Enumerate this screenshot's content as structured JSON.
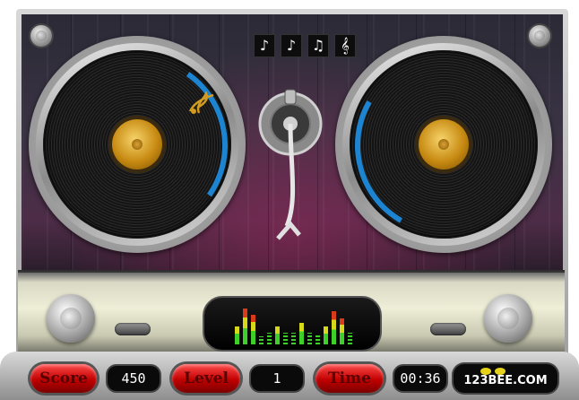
{
  "colors": {
    "accent_blue": "#1d84d1",
    "label_gold": "#d39b1f",
    "pill_red": "#c00000",
    "eq_green": "#3fcf2b",
    "eq_yellow": "#d8d81a",
    "eq_red": "#d83a1a"
  },
  "note_buttons": [
    {
      "symbol": "♪",
      "icon": "eighth-note-icon"
    },
    {
      "symbol": "♪",
      "icon": "eighth-note-icon"
    },
    {
      "symbol": "♫",
      "icon": "beamed-notes-icon"
    },
    {
      "symbol": "𝄞",
      "icon": "treble-clef-icon"
    }
  ],
  "hud": {
    "score_label": "Score",
    "score_value": "450",
    "level_label": "Level",
    "level_value": "1",
    "time_label": "Time",
    "time_value": "00:36"
  },
  "brand": {
    "logo_text": "123BEE.COM"
  },
  "equalizer": {
    "levels": [
      0.45,
      0.9,
      0.75,
      0.2,
      0.3,
      0.45,
      0.3,
      0.3,
      0.55,
      0.3,
      0.25,
      0.45,
      0.85,
      0.65,
      0.3
    ]
  }
}
